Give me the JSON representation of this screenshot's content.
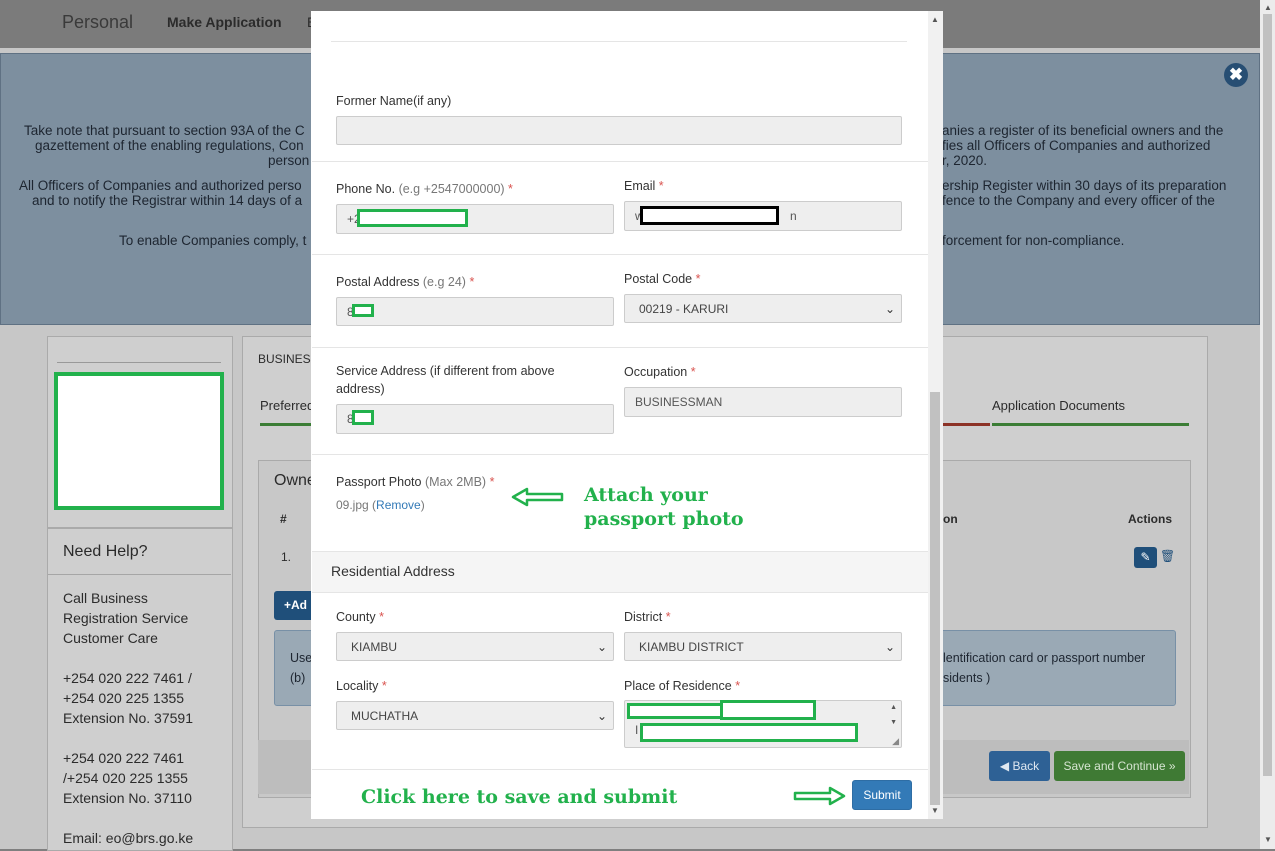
{
  "background": {
    "nav": {
      "brand": "Personal",
      "make_application": "Make Application",
      "next_item": "E"
    },
    "notice_lines": [
      "Take note that pursuant to section 93A of the C",
      "anies a register of its beneficial owners and the",
      "gazettement of the enabling regulations, Con",
      "fies all Officers of Companies and authorized",
      "person",
      "r, 2020.",
      "All Officers of Companies and authorized perso",
      "ership Register within 30 days of its preparation",
      "and to notify the Registrar within 14 days of a",
      "fence to the Company and every officer of the",
      "To enable Companies comply, t",
      "forcement for non-compliance."
    ],
    "close_glyph": "✖",
    "help": {
      "title": "Need Help?",
      "lines": [
        "Call Business",
        "Registration Service",
        "Customer Care",
        "+254 020 222 7461 /",
        "+254 020 225 1355",
        "Extension No. 37591",
        "+254 020 222 7461",
        "/+254 020 225 1355",
        "Extension No. 37110",
        "Email: eo@brs.go.ke"
      ]
    },
    "main": {
      "head": "BUSINESS",
      "tab_preferred": "Preferred",
      "tab_docs": "Application Documents",
      "owners_title": "Owne",
      "col_hash": "#",
      "col_on": "on",
      "col_actions": "Actions",
      "row1_index": "1.",
      "add_label": "+Ad",
      "info_line1_left": "Use",
      "info_line1_right": "lentification card or passport number",
      "info_line2_left": "(b)",
      "info_line2_right": "sidents )",
      "back_label": "Back",
      "save_continue_label": "Save and Continue »"
    }
  },
  "modal": {
    "former_name": {
      "label": "Former Name(if any)",
      "value": ""
    },
    "phone": {
      "label": "Phone No.",
      "hint": "(e.g +2547000000)",
      "value": "+2"
    },
    "email": {
      "label": "Email",
      "value_start": "w",
      "value_end": "n"
    },
    "postal_address": {
      "label": "Postal Address",
      "hint": "(e.g 24)",
      "value": "8"
    },
    "postal_code": {
      "label": "Postal Code",
      "value": "00219 - KARURI"
    },
    "service_address": {
      "label_line1": "Service Address (if different from above",
      "label_line2": "address)",
      "value": "8"
    },
    "occupation": {
      "label": "Occupation",
      "value": "BUSINESSMAN"
    },
    "passport_photo": {
      "label": "Passport Photo",
      "hint": "(Max 2MB)",
      "file": "09.jpg",
      "remove": "Remove"
    },
    "residential_title": "Residential Address",
    "county": {
      "label": "County",
      "value": "KIAMBU"
    },
    "district": {
      "label": "District",
      "value": "KIAMBU DISTRICT"
    },
    "locality": {
      "label": "Locality",
      "value": "MUCHATHA"
    },
    "place_of_residence": {
      "label": "Place of Residence",
      "line2_start": "I"
    },
    "submit_label": "Submit",
    "required_mark": "*"
  },
  "annotations": {
    "attach_line1": "Attach your",
    "attach_line2": "passport photo",
    "save_submit": "Click here to save and submit"
  },
  "colors": {
    "annotation_green": "#22b14c",
    "submit_blue": "#337ab7",
    "required_red": "#d9534f"
  }
}
